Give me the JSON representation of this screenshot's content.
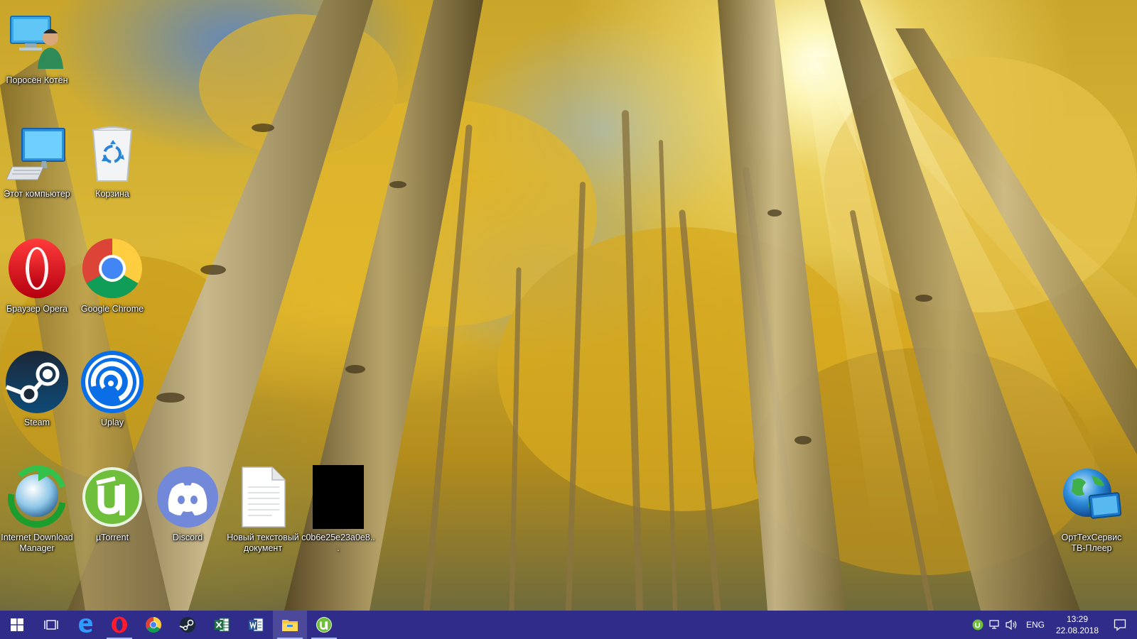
{
  "desktop": {
    "icons": [
      {
        "id": "user",
        "label": "Поросён Котён"
      },
      {
        "id": "this-pc",
        "label": "Этот компьютер"
      },
      {
        "id": "recycle-bin",
        "label": "Корзина"
      },
      {
        "id": "opera",
        "label": "Браузер Opera"
      },
      {
        "id": "chrome",
        "label": "Google Chrome"
      },
      {
        "id": "steam",
        "label": "Steam"
      },
      {
        "id": "uplay",
        "label": "Uplay"
      },
      {
        "id": "idm",
        "label": "Internet Download Manager"
      },
      {
        "id": "utorrent",
        "label": "µTorrent"
      },
      {
        "id": "discord",
        "label": "Discord"
      },
      {
        "id": "new-text-doc",
        "label": "Новый текстовый документ"
      },
      {
        "id": "image-file",
        "label": "c0b6e25e23a0e8..."
      },
      {
        "id": "orttech-tv",
        "label": "ОртТехСервис ТВ-Плеер"
      }
    ]
  },
  "taskbar": {
    "pinned": [
      "start",
      "task-view",
      "edge",
      "opera",
      "chrome",
      "steam",
      "excel",
      "word",
      "file-explorer",
      "utorrent"
    ],
    "tray": {
      "language": "ENG",
      "time": "13:29",
      "date": "22.08.2018"
    },
    "colors": {
      "background": "#2f2c8a",
      "indicator": "#a9b6ff"
    }
  }
}
